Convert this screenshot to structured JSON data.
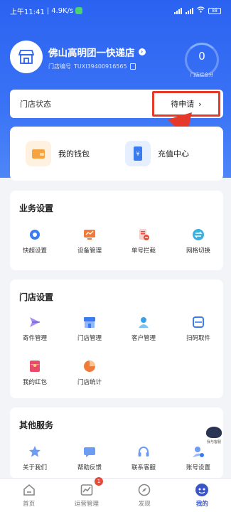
{
  "status_bar": {
    "time": "上午11:41",
    "speed": "4.9K/s",
    "battery": "88"
  },
  "store": {
    "name": "佛山高明团一快递店",
    "id_label": "门店编号",
    "id_value": "TUXI39400916565",
    "score": "0",
    "score_label": "门店综合分"
  },
  "store_status": {
    "label": "门店状态",
    "value": "待申请"
  },
  "wallet": {
    "my_wallet": "我的钱包",
    "recharge": "充值中心"
  },
  "business_settings": {
    "title": "业务设置",
    "items": [
      {
        "label": "快超设置",
        "icon": "gear-icon",
        "color": "#3a7cf0"
      },
      {
        "label": "设备管理",
        "icon": "monitor-icon",
        "color": "#f07a3a"
      },
      {
        "label": "单号拦截",
        "icon": "phone-block-icon",
        "color": "#e5503a"
      },
      {
        "label": "网格切换",
        "icon": "swap-icon",
        "color": "#3ab0e0"
      }
    ]
  },
  "store_settings": {
    "title": "门店设置",
    "items": [
      {
        "label": "寄件管理",
        "icon": "send-icon",
        "color": "#8a6ae8"
      },
      {
        "label": "门店管理",
        "icon": "store-icon",
        "color": "#3a7cf0"
      },
      {
        "label": "客户管理",
        "icon": "customer-icon",
        "color": "#3aa0e8"
      },
      {
        "label": "扫码取件",
        "icon": "scan-icon",
        "color": "#3a7cf0"
      },
      {
        "label": "我的红包",
        "icon": "red-packet-icon",
        "color": "#e84a6a"
      },
      {
        "label": "门店统计",
        "icon": "pie-chart-icon",
        "color": "#f07a3a"
      }
    ]
  },
  "other_services": {
    "title": "其他服务",
    "items": [
      {
        "label": "关于我们",
        "icon": "star-icon",
        "color": "#3a7cf0"
      },
      {
        "label": "帮助反馈",
        "icon": "feedback-icon",
        "color": "#3a7cf0"
      },
      {
        "label": "联系客服",
        "icon": "headset-icon",
        "color": "#3a7cf0"
      },
      {
        "label": "账号设置",
        "icon": "account-gear-icon",
        "color": "#3a7cf0"
      }
    ]
  },
  "floater_label": "我与客服",
  "tabs": [
    {
      "label": "首页",
      "icon": "home-icon"
    },
    {
      "label": "运营管理",
      "icon": "chart-icon",
      "badge": "1"
    },
    {
      "label": "发现",
      "icon": "compass-icon"
    },
    {
      "label": "我的",
      "icon": "profile-icon"
    }
  ]
}
